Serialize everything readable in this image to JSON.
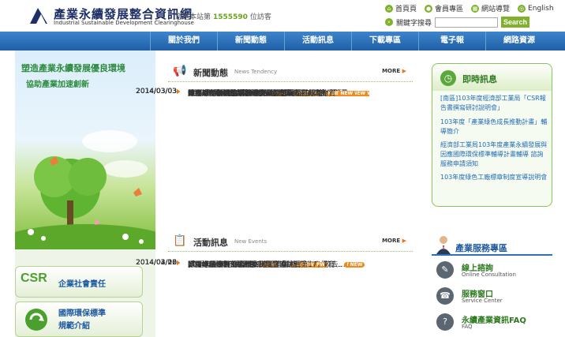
{
  "header": {
    "site_title": "產業永續發展整合資訊網",
    "site_subtitle": "Industrial Sustainable Development Clearinghouse",
    "visitor_prefix": "您是本站第",
    "visitor_count": "1555590",
    "visitor_suffix": "位訪客",
    "top_links": [
      "首頁頁",
      "會員專區",
      "網站導覽",
      "English"
    ],
    "search_label": "關鍵字搜尋",
    "search_placeholder": "",
    "search_button": "Search"
  },
  "nav": {
    "items": [
      "關於我們",
      "新聞動態",
      "活動訊息",
      "下載專區",
      "電子報",
      "網路資源"
    ]
  },
  "banner": {
    "line1": "塑造產業永續發展優良環境",
    "line2": "協助產業加速創新"
  },
  "side_links": [
    {
      "logo": "CSR",
      "label": "企業社會責任"
    },
    {
      "logo": "",
      "label_l1": "國際環保標準",
      "label_l2": "規範介紹"
    }
  ],
  "news": {
    "title": "新聞動態",
    "title_en": "News Tendency",
    "more": "MORE",
    "new_badge": "NEW",
    "items": [
      {
        "title": "2月焦點-各國企業社會責任政策介紹與趨勢分析",
        "date": "2014/03/03"
      },
      {
        "title": "歐盟近期永續生產與消費之發展重點",
        "date": "2014/03/03"
      },
      {
        "title": "2014世界經濟論壇：循環經濟正逐漸改變當代消費…",
        "date": "2014/03/03"
      },
      {
        "title": "促進綠色投資的10種方法",
        "date": "2014/03/03"
      },
      {
        "title": "綠色產品貿易協議在達沃斯論壇開幕",
        "date": "2014/03/03"
      },
      {
        "title": "2014年驅動永續發展的關鍵力量",
        "date": "2014/03/03"
      },
      {
        "title": "美國環保署公告「能源之星」電視產品規格6.1版…",
        "date": "2014/03/03"
      },
      {
        "title": "國際環保紡織協會頒布2014版Oeko-Tex…",
        "date": "2014/03/03"
      },
      {
        "title": "歐盟ErP指令廚房用具產品實施方法正式公告",
        "date": "2014/03/03"
      },
      {
        "title": "2014年美國至少有33個州會立法限制有毒物質",
        "date": "2014/03/03"
      }
    ]
  },
  "events": {
    "title": "活動訊息",
    "title_en": "New Events",
    "more": "MORE",
    "new_badge": "NEW",
    "items": [
      {
        "title": "[南區]103年度經濟部工業局「CSR報告書撰寫…",
        "date": "2014/04/02"
      },
      {
        "title": "「兩岸服務貿易協議」資訊饗宴",
        "date": "2014/03/26"
      },
      {
        "title": "臺灣經濟發展的大戰略",
        "date": "2014/03/20"
      },
      {
        "title": "103年度綠色工廠標章制度宣導說明會",
        "date": "2014/03/12"
      },
      {
        "title": "歐盟綠色設計 環保資訊產品有哪些",
        "date": "2014/02/26"
      },
      {
        "title": "2014年經濟自由貿易-我國全球挑戰第17，較去…",
        "date": "2014/02/26"
      }
    ]
  },
  "instant": {
    "title": "即時訊息",
    "items": [
      "[南區]103年度經濟部工業局「CSR報告書撰寫研討說明會」",
      "103年度「產業綠色成長推動計畫」輔導簡介",
      "經濟部工業局103年度產業永續發展與因應國際環保標準輔導計畫輔導 諮詢服務申請須知",
      "103年度綠色工廠標章制度宣導說明會"
    ]
  },
  "service": {
    "title": "產業服務專區",
    "items": [
      {
        "label": "線上諮詢",
        "en": "Online Consultation"
      },
      {
        "label": "服務窗口",
        "en": "Service Center"
      },
      {
        "label": "永續產業資訊FAQ",
        "en": "FAQ"
      }
    ]
  },
  "colors": {
    "nav_blue": "#1f5fa8",
    "accent_green": "#7fb12b",
    "new_orange": "#f08a1c"
  }
}
